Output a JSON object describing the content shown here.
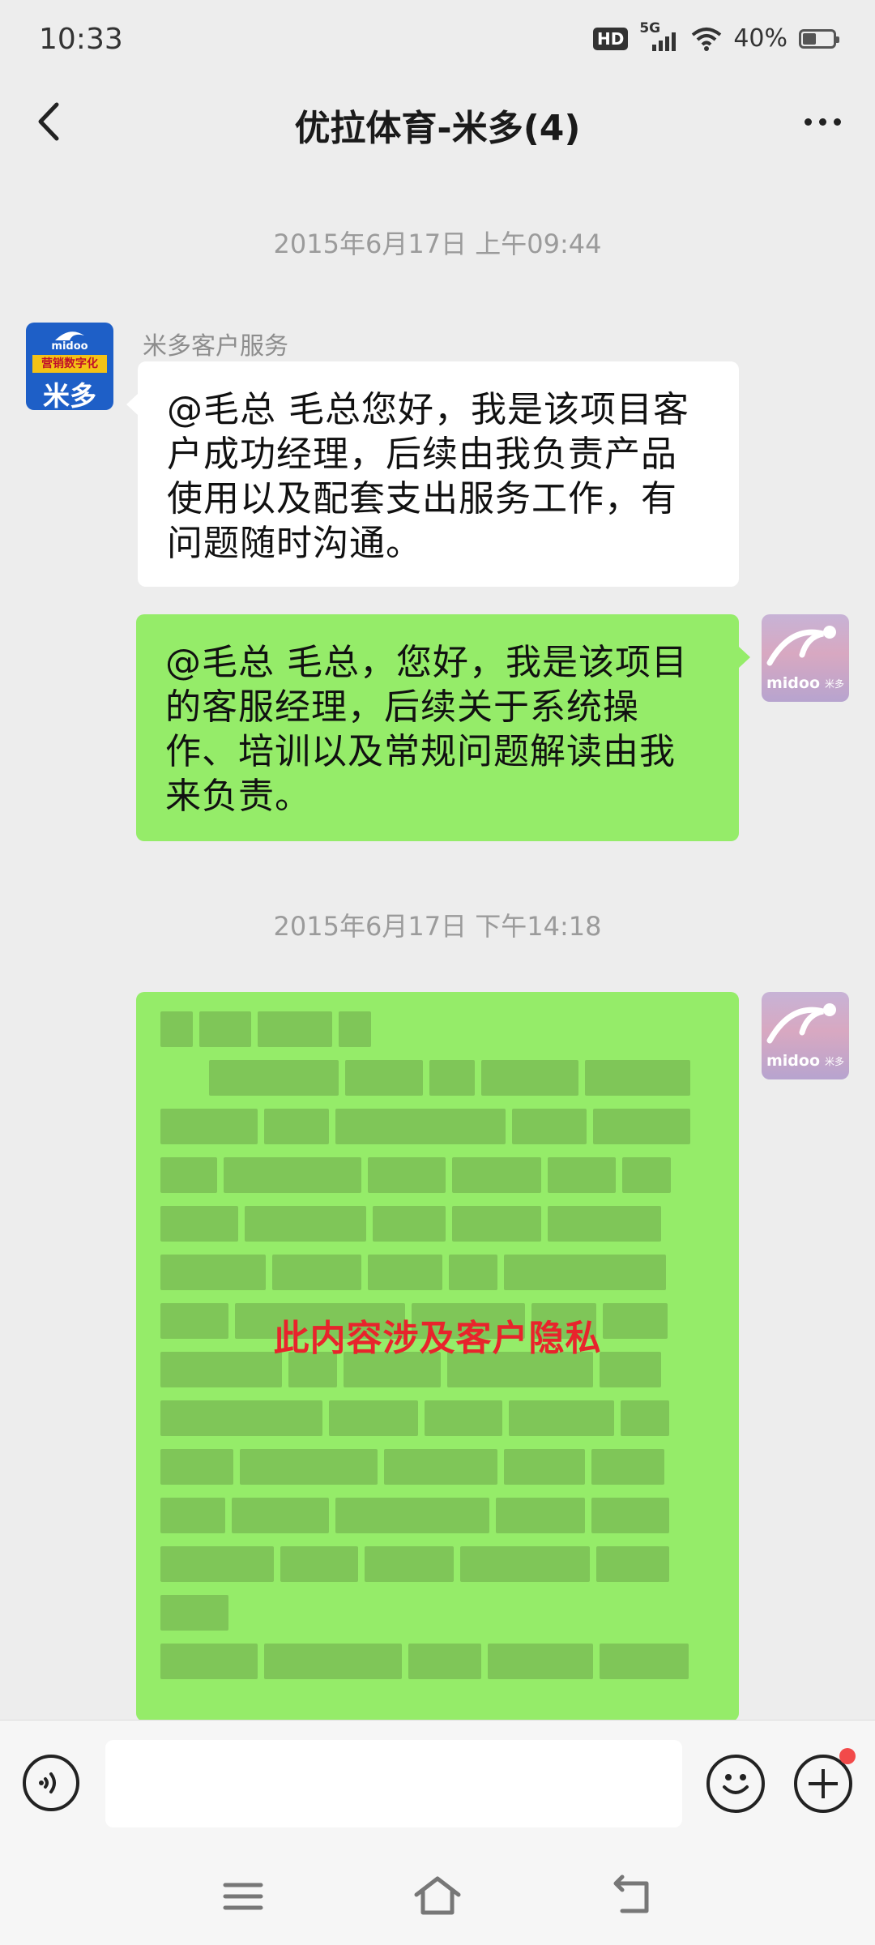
{
  "status_bar": {
    "time": "10:33",
    "hd_badge": "HD",
    "network": "5G",
    "battery_percent_label": "40%",
    "battery_level": 0.4
  },
  "header": {
    "title": "优拉体育-米多(4)"
  },
  "messages": [
    {
      "type": "timestamp",
      "text": "2015年6月17日  上午09:44"
    },
    {
      "type": "incoming",
      "sender": "米多客户服务",
      "avatar": {
        "brand_word": "midoo",
        "tag": "营销数字化",
        "name": "米多"
      },
      "text": "@毛总  毛总您好，我是该项目客户成功经理，后续由我负责产品使用以及配套支出服务工作，有问题随时沟通。"
    },
    {
      "type": "outgoing",
      "avatar": {
        "brand_word": "midoo",
        "cn": "米多"
      },
      "text": "@毛总  毛总，您好，我是该项目的客服经理，后续关于系统操作、培训以及常规问题解读由我来负责。"
    },
    {
      "type": "timestamp",
      "text": "2015年6月17日  下午14:18"
    },
    {
      "type": "outgoing-obscured",
      "avatar": {
        "brand_word": "midoo",
        "cn": "米多"
      },
      "overlay_text": "此内容涉及客户隐私"
    }
  ],
  "input_bar": {
    "placeholder": ""
  },
  "colors": {
    "background": "#ededed",
    "outgoing_bubble": "#95ec69",
    "incoming_bubble": "#ffffff",
    "privacy_text": "#e8242c",
    "badge_dot": "#f24a4a"
  },
  "icons": {
    "back": "chevron-left-icon",
    "more": "more-dots-icon",
    "voice": "voice-icon",
    "emoji": "emoji-icon",
    "plus": "plus-icon",
    "nav_menu": "menu-icon",
    "nav_home": "home-icon",
    "nav_back": "back-arrow-icon"
  }
}
